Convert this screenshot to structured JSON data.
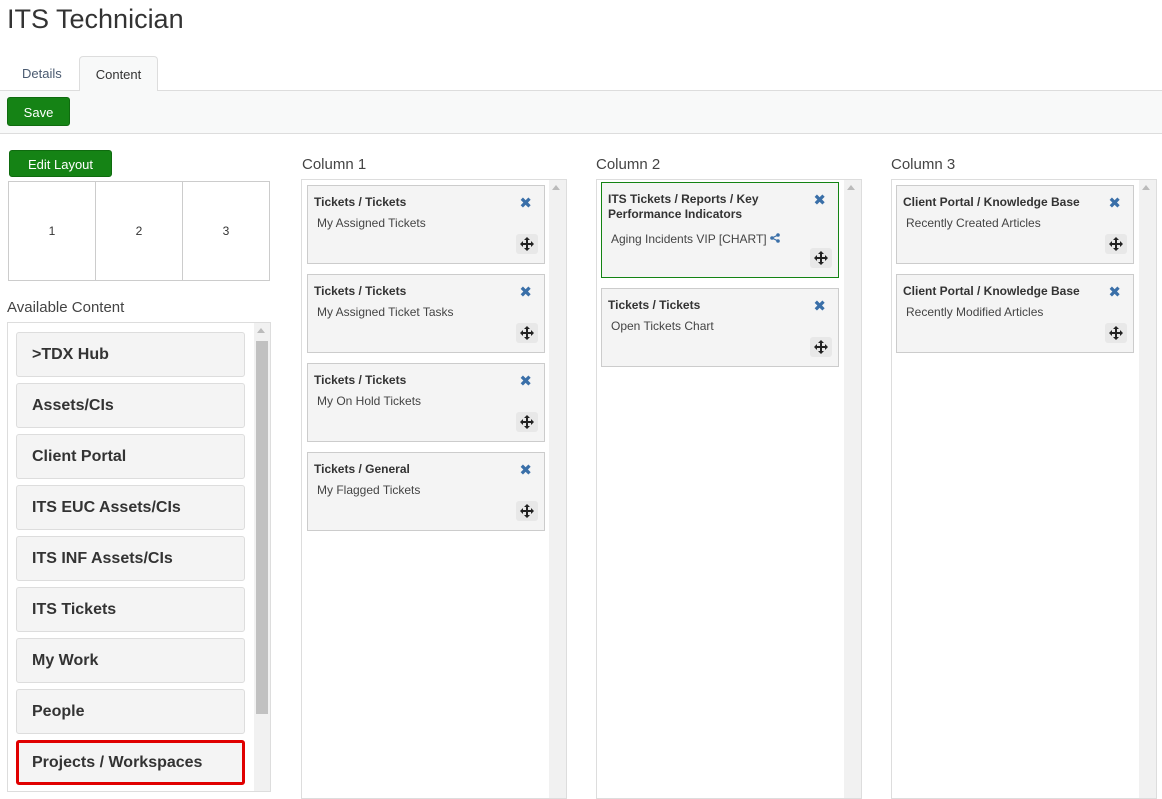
{
  "page": {
    "title": "ITS Technician"
  },
  "tabs": [
    {
      "label": "Details",
      "active": false
    },
    {
      "label": "Content",
      "active": true
    }
  ],
  "toolbar": {
    "save_label": "Save"
  },
  "layout": {
    "edit_label": "Edit Layout",
    "cells": [
      "1",
      "2",
      "3"
    ]
  },
  "available": {
    "label": "Available Content",
    "items": [
      ">TDX Hub",
      "Assets/CIs",
      "Client Portal",
      "ITS EUC Assets/CIs",
      "ITS INF Assets/CIs",
      "ITS Tickets",
      "My Work",
      "People",
      "Projects / Workspaces"
    ],
    "highlighted": "Projects / Workspaces"
  },
  "columns": [
    {
      "label": "Column 1",
      "cards": [
        {
          "title": "Tickets / Tickets",
          "subtitle": "My Assigned Tickets"
        },
        {
          "title": "Tickets / Tickets",
          "subtitle": "My Assigned Ticket Tasks"
        },
        {
          "title": "Tickets / Tickets",
          "subtitle": "My On Hold Tickets"
        },
        {
          "title": "Tickets / General",
          "subtitle": "My Flagged Tickets"
        }
      ]
    },
    {
      "label": "Column 2",
      "cards": [
        {
          "title": "ITS Tickets / Reports / Key Performance Indicators",
          "subtitle": "Aging Incidents VIP [CHART]",
          "shared": true,
          "selected": true
        },
        {
          "title": "Tickets / Tickets",
          "subtitle": "Open Tickets Chart"
        }
      ]
    },
    {
      "label": "Column 3",
      "cards": [
        {
          "title": "Client Portal / Knowledge Base",
          "subtitle": "Recently Created Articles"
        },
        {
          "title": "Client Portal / Knowledge Base",
          "subtitle": "Recently Modified Articles"
        }
      ]
    }
  ],
  "icons": {
    "close": "close-x-icon",
    "move": "move-arrows-icon",
    "share": "share-icon"
  },
  "colors": {
    "primary_button": "#158315",
    "close_icon": "#3a6fa8",
    "highlight": "#e00000"
  }
}
